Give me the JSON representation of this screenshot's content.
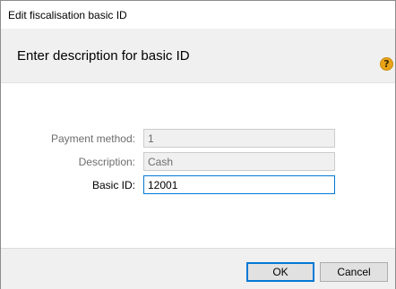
{
  "window": {
    "title": "Edit fiscalisation basic ID"
  },
  "header": {
    "text": "Enter description for basic ID",
    "help_icon": "question-mark-icon",
    "help_glyph": "?"
  },
  "form": {
    "payment_method": {
      "label": "Payment method:",
      "value": "1",
      "enabled": false
    },
    "description": {
      "label": "Description:",
      "value": "Cash",
      "enabled": false
    },
    "basic_id": {
      "label": "Basic ID:",
      "value": "12001",
      "enabled": true
    }
  },
  "buttons": {
    "ok": "OK",
    "cancel": "Cancel"
  },
  "colors": {
    "focus_border": "#0078d7",
    "header_bg": "#f0f0f0",
    "help_icon": "#e8a317"
  }
}
